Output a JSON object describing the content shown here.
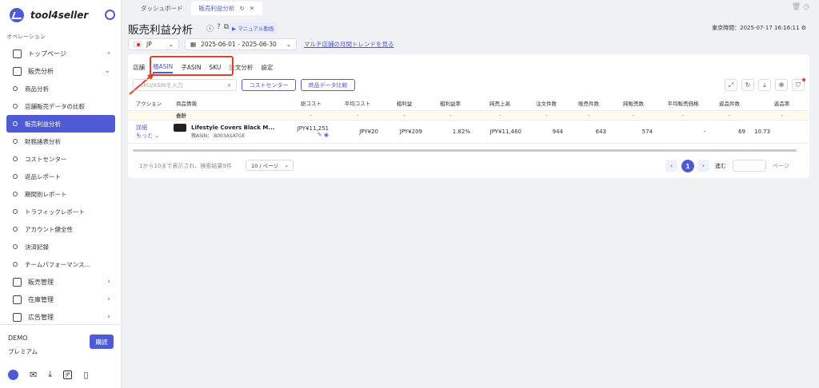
{
  "app": {
    "name": "tool4seller"
  },
  "sidebar": {
    "section_label": "オペレーション",
    "items": [
      {
        "label": "トップページ",
        "icon": "home-icon",
        "chevron": "›"
      },
      {
        "label": "販売分析",
        "icon": "chart-icon",
        "chevron": "⌄"
      },
      {
        "label": "商品分析"
      },
      {
        "label": "店舗販売データの比較"
      },
      {
        "label": "販売利益分析",
        "active": true
      },
      {
        "label": "財務諸表分析"
      },
      {
        "label": "コストセンター"
      },
      {
        "label": "返品レポート"
      },
      {
        "label": "期間別レポート"
      },
      {
        "label": "トラフィックレポート"
      },
      {
        "label": "アカウント健全性"
      },
      {
        "label": "決済記録"
      },
      {
        "label": "チームパフォーマンス..."
      },
      {
        "label": "販売管理",
        "icon": "sales-icon",
        "chevron": "›"
      },
      {
        "label": "在庫管理",
        "icon": "inventory-icon",
        "chevron": "›"
      },
      {
        "label": "広告管理",
        "icon": "ads-icon",
        "chevron": "›"
      }
    ],
    "account": {
      "name": "DEMO",
      "plan": "プレミアム",
      "buy_label": "購読"
    },
    "bottom_jp": "JP"
  },
  "tabbar": {
    "tabs": [
      {
        "label": "ダッシュボード"
      },
      {
        "label": "販売利益分析",
        "active": true
      }
    ]
  },
  "header": {
    "title": "販売利益分析",
    "manual_label": "マニュアル動画",
    "tokyo_time": "東京時間：2025-07-17 16:16:11",
    "marketplace": "JP",
    "date_range": "2025-06-01 - 2025-06-30",
    "trend_link": "マルチ店舗の月間トレンドを見る"
  },
  "subtabs": [
    {
      "label": "店舗"
    },
    {
      "label": "親ASIN",
      "active": true
    },
    {
      "label": "子ASIN"
    },
    {
      "label": "SKU"
    },
    {
      "label": "注文分析"
    },
    {
      "label": "設定"
    }
  ],
  "toolbar": {
    "search_placeholder": "SKU/ASINを入力",
    "cost_center_label": "コストセンター",
    "compare_label": "商品データ比較"
  },
  "table": {
    "headers": [
      "アクション",
      "商品情報",
      "総コスト",
      "平均コスト",
      "粗利益",
      "粗利益率",
      "純売上高",
      "注文件数",
      "販売件数",
      "純販売数",
      "平均販売価格",
      "返品件数",
      "返品率"
    ],
    "total_label": "合計",
    "total_row": [
      "-",
      "-",
      "-",
      "-",
      "-",
      "-",
      "-",
      "-",
      "-",
      "-",
      "-"
    ],
    "row": {
      "action_detail": "詳細",
      "action_more": "もっと",
      "product_name": "Lifestyle Covers Black M...",
      "product_asin": "親ASIN： B003ASATGE",
      "total_cost": "JPY¥11,251",
      "avg_cost": "JPY¥20",
      "gross_profit": "JPY¥209",
      "gross_margin": "1.82%",
      "net_sales": "JPY¥11,460",
      "orders": "944",
      "units": "643",
      "net_units": "574",
      "avg_price": "-",
      "returns": "69",
      "return_rate": "10.73"
    }
  },
  "pager": {
    "summary": "1から10まで表示され、検索結果9件",
    "page_size": "10 / ページ",
    "current_page": "1",
    "goto_label": "進む",
    "page_label": "ページ"
  }
}
